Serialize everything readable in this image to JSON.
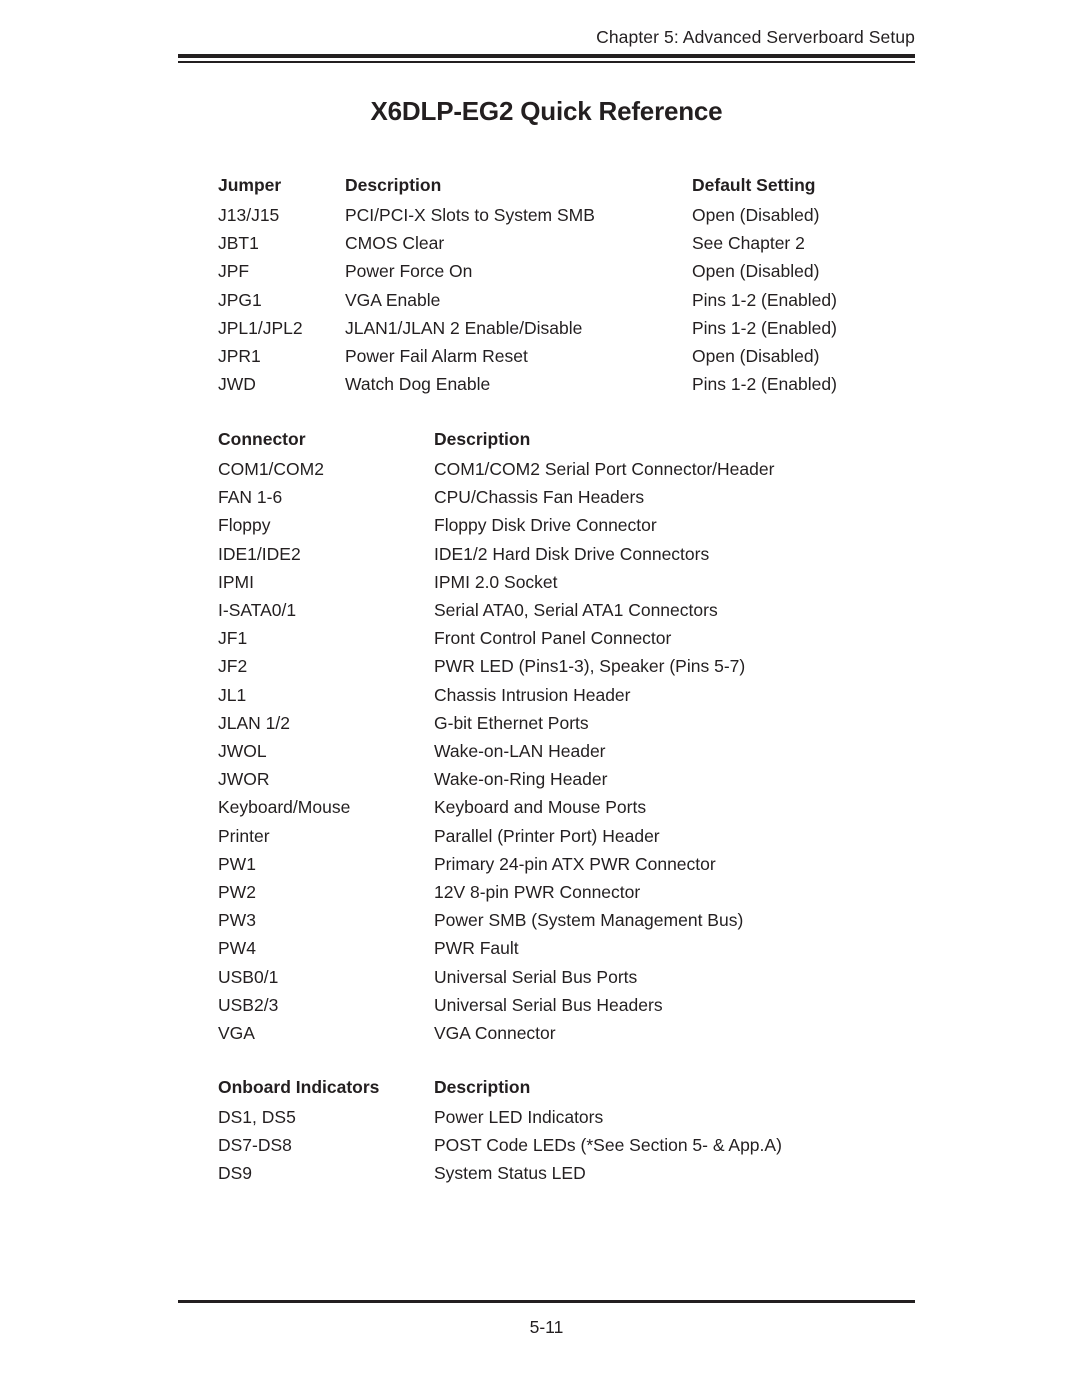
{
  "header": {
    "chapter_text": "Chapter 5: Advanced Serverboard Setup"
  },
  "title": "X6DLP-EG2 Quick Reference",
  "jumper_table": {
    "headers": [
      "Jumper",
      "Description",
      "Default Setting"
    ],
    "rows": [
      [
        "J13/J15",
        "PCI/PCI-X Slots to System SMB",
        "Open (Disabled)"
      ],
      [
        "JBT1",
        "CMOS Clear",
        "See Chapter 2"
      ],
      [
        "JPF",
        "Power Force On",
        "Open (Disabled)"
      ],
      [
        "JPG1",
        "VGA Enable",
        "Pins 1-2 (Enabled)"
      ],
      [
        "JPL1/JPL2",
        "JLAN1/JLAN 2 Enable/Disable",
        "Pins 1-2 (Enabled)"
      ],
      [
        "JPR1",
        "Power Fail Alarm Reset",
        "Open (Disabled)"
      ],
      [
        "JWD",
        "Watch Dog Enable",
        "Pins 1-2 (Enabled)"
      ]
    ]
  },
  "connector_table": {
    "headers": [
      "Connector",
      "Description"
    ],
    "rows": [
      [
        "COM1/COM2",
        "COM1/COM2 Serial Port Connector/Header"
      ],
      [
        "FAN 1-6",
        "CPU/Chassis Fan Headers"
      ],
      [
        "Floppy",
        "Floppy Disk Drive Connector"
      ],
      [
        "IDE1/IDE2",
        "IDE1/2 Hard Disk Drive Connectors"
      ],
      [
        "IPMI",
        "IPMI 2.0 Socket"
      ],
      [
        "I-SATA0/1",
        "Serial ATA0, Serial ATA1 Connectors"
      ],
      [
        "JF1",
        "Front Control Panel Connector"
      ],
      [
        "JF2",
        "PWR LED (Pins1-3), Speaker (Pins 5-7)"
      ],
      [
        "JL1",
        "Chassis Intrusion Header"
      ],
      [
        "JLAN 1/2",
        "G-bit Ethernet Ports"
      ],
      [
        "JWOL",
        "Wake-on-LAN Header"
      ],
      [
        "JWOR",
        "Wake-on-Ring Header"
      ],
      [
        "Keyboard/Mouse",
        "Keyboard and Mouse Ports"
      ],
      [
        "Printer",
        "Parallel (Printer Port) Header"
      ],
      [
        "PW1",
        "Primary 24-pin ATX PWR Connector"
      ],
      [
        "PW2",
        "12V 8-pin PWR Connector"
      ],
      [
        "PW3",
        "Power SMB (System Management Bus)"
      ],
      [
        "PW4",
        "PWR Fault"
      ],
      [
        "USB0/1",
        "Universal Serial Bus Ports"
      ],
      [
        "USB2/3",
        "Universal Serial Bus Headers"
      ],
      [
        "VGA",
        "VGA Connector"
      ]
    ]
  },
  "indicators_table": {
    "headers": [
      "Onboard Indicators",
      "Description"
    ],
    "rows": [
      [
        "DS1, DS5",
        "Power LED Indicators"
      ],
      [
        "DS7-DS8",
        "POST Code LEDs (*See Section 5- & App.A)"
      ],
      [
        "DS9",
        "System Status LED"
      ]
    ]
  },
  "footer": {
    "page_number": "5-11"
  }
}
